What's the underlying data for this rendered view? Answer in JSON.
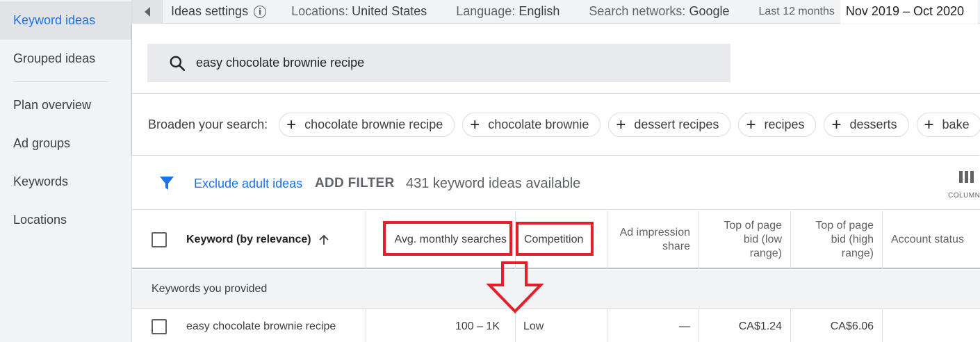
{
  "sidebar": {
    "items": [
      {
        "label": "Keyword ideas",
        "active": true
      },
      {
        "label": "Grouped ideas"
      },
      {
        "label": "Plan overview"
      },
      {
        "label": "Ad groups"
      },
      {
        "label": "Keywords"
      },
      {
        "label": "Locations"
      }
    ]
  },
  "topbar": {
    "ideas_settings": "Ideas settings",
    "locations_label": "Locations:",
    "locations_value": "United States",
    "language_label": "Language:",
    "language_value": "English",
    "networks_label": "Search networks:",
    "networks_value": "Google",
    "period_label": "Last 12 months",
    "date_range": "Nov 2019 – Oct 2020"
  },
  "search": {
    "query": "easy chocolate brownie recipe"
  },
  "broaden": {
    "label": "Broaden your search:",
    "chips": [
      "chocolate brownie recipe",
      "chocolate brownie",
      "dessert recipes",
      "recipes",
      "desserts",
      "bake"
    ]
  },
  "filterbar": {
    "exclude_adult": "Exclude adult ideas",
    "add_filter": "ADD FILTER",
    "count_text": "431 keyword ideas available",
    "columns_label": "COLUMNS"
  },
  "table": {
    "headers": {
      "keyword": "Keyword (by relevance)",
      "avg_searches": "Avg. monthly searches",
      "competition": "Competition",
      "ad_impression": "Ad impression share",
      "bid_low": "Top of page bid (low range)",
      "bid_high": "Top of page bid (high range)",
      "account_status": "Account status"
    },
    "group_label": "Keywords you provided",
    "rows": [
      {
        "keyword": "easy chocolate brownie recipe",
        "avg_searches": "100 – 1K",
        "competition": "Low",
        "ad_impression": "—",
        "bid_low": "CA$1.24",
        "bid_high": "CA$6.06",
        "account_status": ""
      }
    ]
  },
  "colors": {
    "accent": "#1a73e8",
    "annotation": "#e41e2b",
    "sidebar_bg": "#f1f3f4"
  }
}
